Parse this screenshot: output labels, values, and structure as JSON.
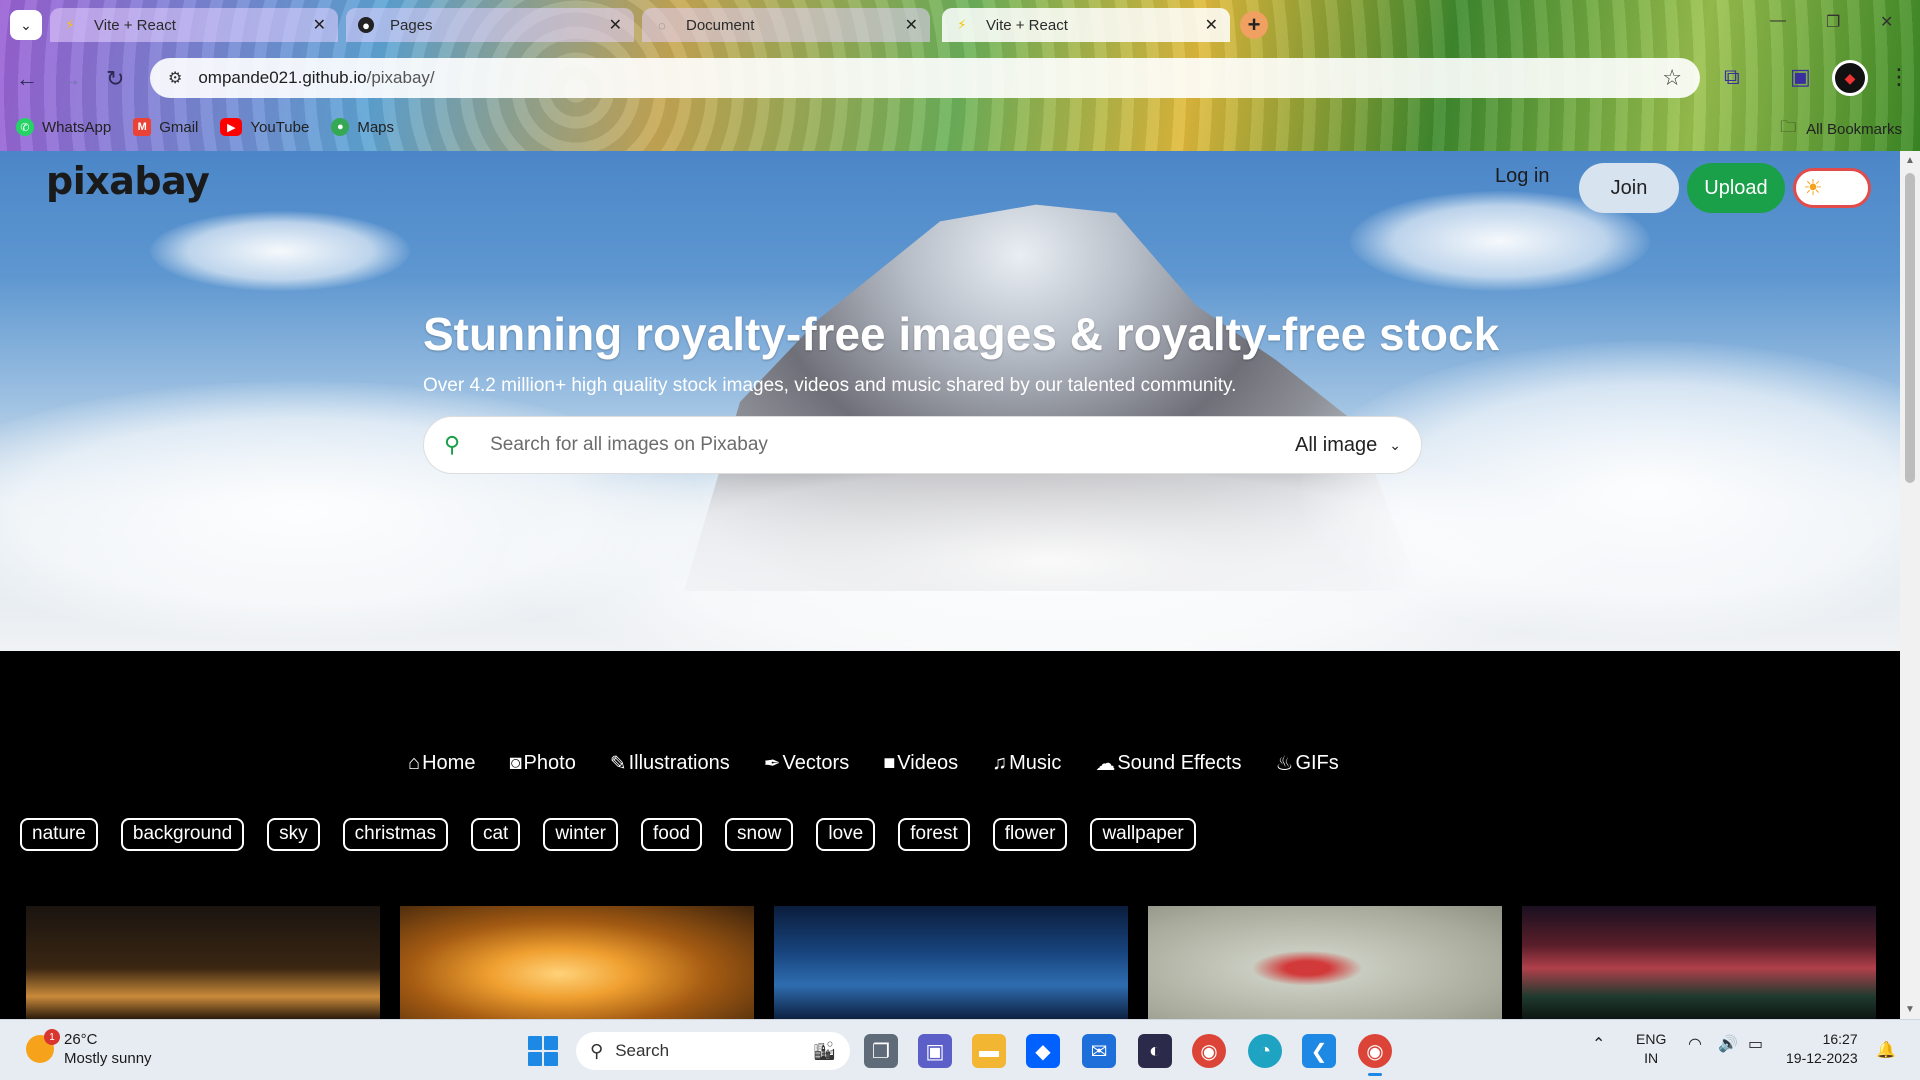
{
  "browser": {
    "tabs": [
      {
        "title": "Vite + React",
        "favicon": "vite-icon"
      },
      {
        "title": "Pages",
        "favicon": "github-icon"
      },
      {
        "title": "Document",
        "favicon": "globe-icon"
      },
      {
        "title": "Vite + React",
        "favicon": "vite-icon",
        "active": true
      }
    ],
    "url_host": "ompande021.github.io",
    "url_path": "/pixabay/",
    "bookmarks": [
      {
        "label": "WhatsApp",
        "icon": "whatsapp-icon",
        "color": "#25d366"
      },
      {
        "label": "Gmail",
        "icon": "gmail-icon",
        "color": "#ea4335"
      },
      {
        "label": "YouTube",
        "icon": "youtube-icon",
        "color": "#ff0000"
      },
      {
        "label": "Maps",
        "icon": "maps-icon",
        "color": "#34a853"
      }
    ],
    "all_bookmarks": "All Bookmarks"
  },
  "site": {
    "logo": "pixabay",
    "login": "Log in",
    "join": "Join",
    "upload": "Upload",
    "brand_color": "#1ba04a",
    "headline": "Stunning royalty-free images & royalty-free stock",
    "subline": "Over 4.2 million+ high quality stock images, videos and music shared by our talented community.",
    "search_placeholder": "Search for all images on Pixabay",
    "search_type": "All image",
    "categories": [
      {
        "label": "Home",
        "icon": "home-icon"
      },
      {
        "label": "Photo",
        "icon": "camera-icon"
      },
      {
        "label": "Illustrations",
        "icon": "brush-icon"
      },
      {
        "label": "Vectors",
        "icon": "pen-icon"
      },
      {
        "label": "Videos",
        "icon": "video-icon"
      },
      {
        "label": "Music",
        "icon": "music-icon"
      },
      {
        "label": "Sound Effects",
        "icon": "cloud-icon"
      },
      {
        "label": "GIFs",
        "icon": "fire-icon"
      }
    ],
    "tags": [
      "nature",
      "background",
      "sky",
      "christmas",
      "cat",
      "winter",
      "food",
      "snow",
      "love",
      "forest",
      "flower",
      "wallpaper"
    ]
  },
  "taskbar": {
    "weather_temp": "26°C",
    "weather_desc": "Mostly sunny",
    "weather_badge": "1",
    "search": "Search",
    "lang_top": "ENG",
    "lang_bottom": "IN",
    "time": "16:27",
    "date": "19-12-2023"
  }
}
